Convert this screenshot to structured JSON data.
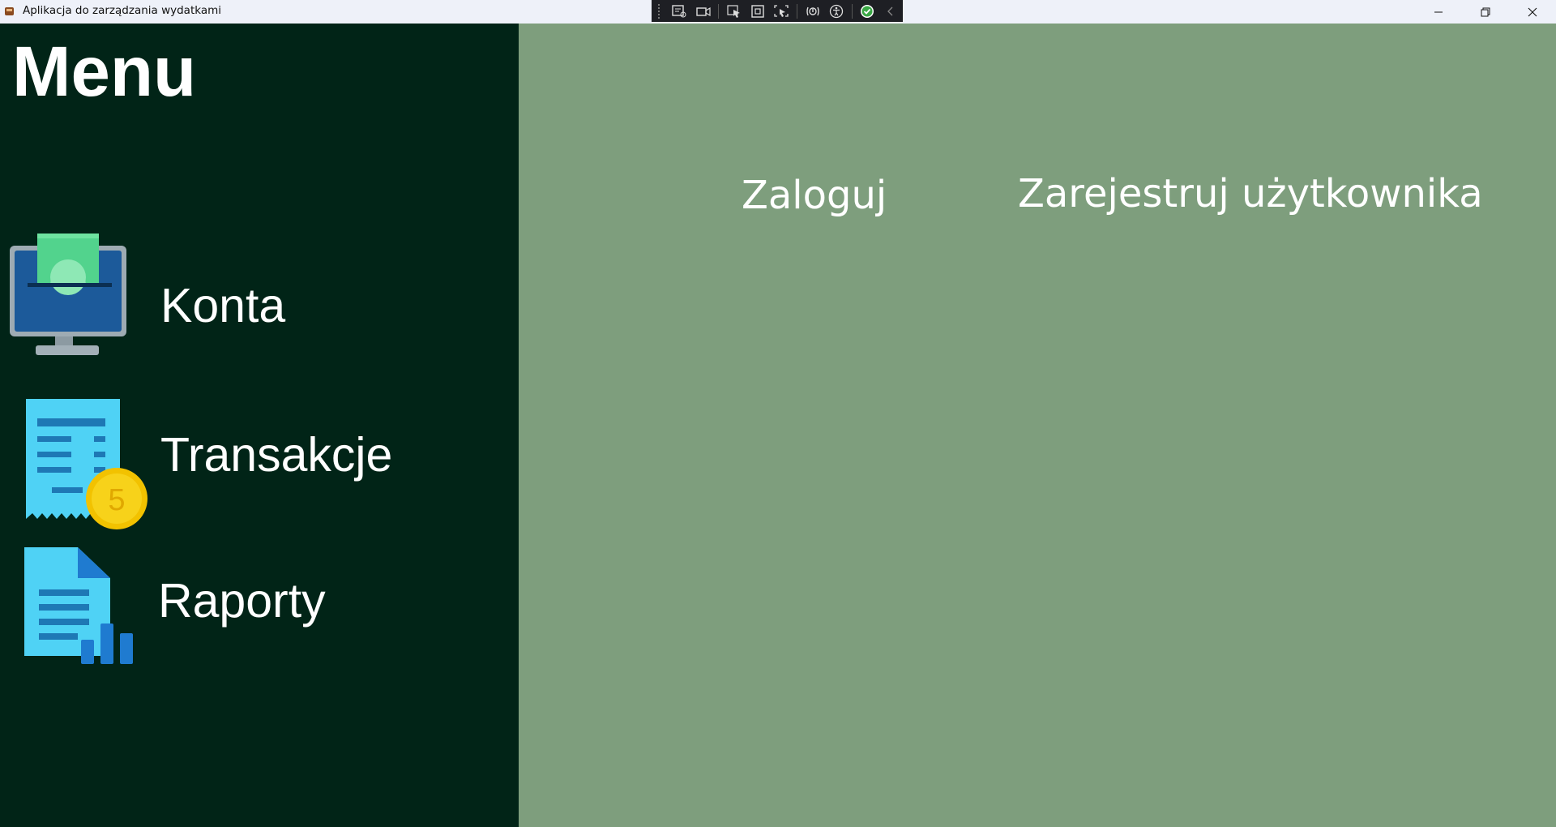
{
  "window": {
    "title": "Aplikacja do zarządzania wydatkami",
    "controls": [
      "minimize-icon",
      "restore-icon",
      "close-icon"
    ]
  },
  "debug_toolbar": {
    "icons": [
      "live-visual-tree-icon",
      "video-icon",
      "select-element-icon",
      "display-layout-adorners-icon",
      "track-focus-icon",
      "binding-failures-icon",
      "accessibility-icon",
      "check-icon",
      "collapse-chevron-icon"
    ]
  },
  "sidebar": {
    "title": "Menu",
    "items": [
      {
        "label": "Konta",
        "icon": "monitor-money-icon"
      },
      {
        "label": "Transakcje",
        "icon": "receipt-coin-icon"
      },
      {
        "label": "Raporty",
        "icon": "report-chart-icon"
      }
    ]
  },
  "main": {
    "login_label": "Zaloguj",
    "register_label": "Zarejestruj użytkownika"
  },
  "colors": {
    "sidebar_bg": "#012417",
    "main_bg": "#7e9e7d",
    "text": "#ffffff"
  }
}
